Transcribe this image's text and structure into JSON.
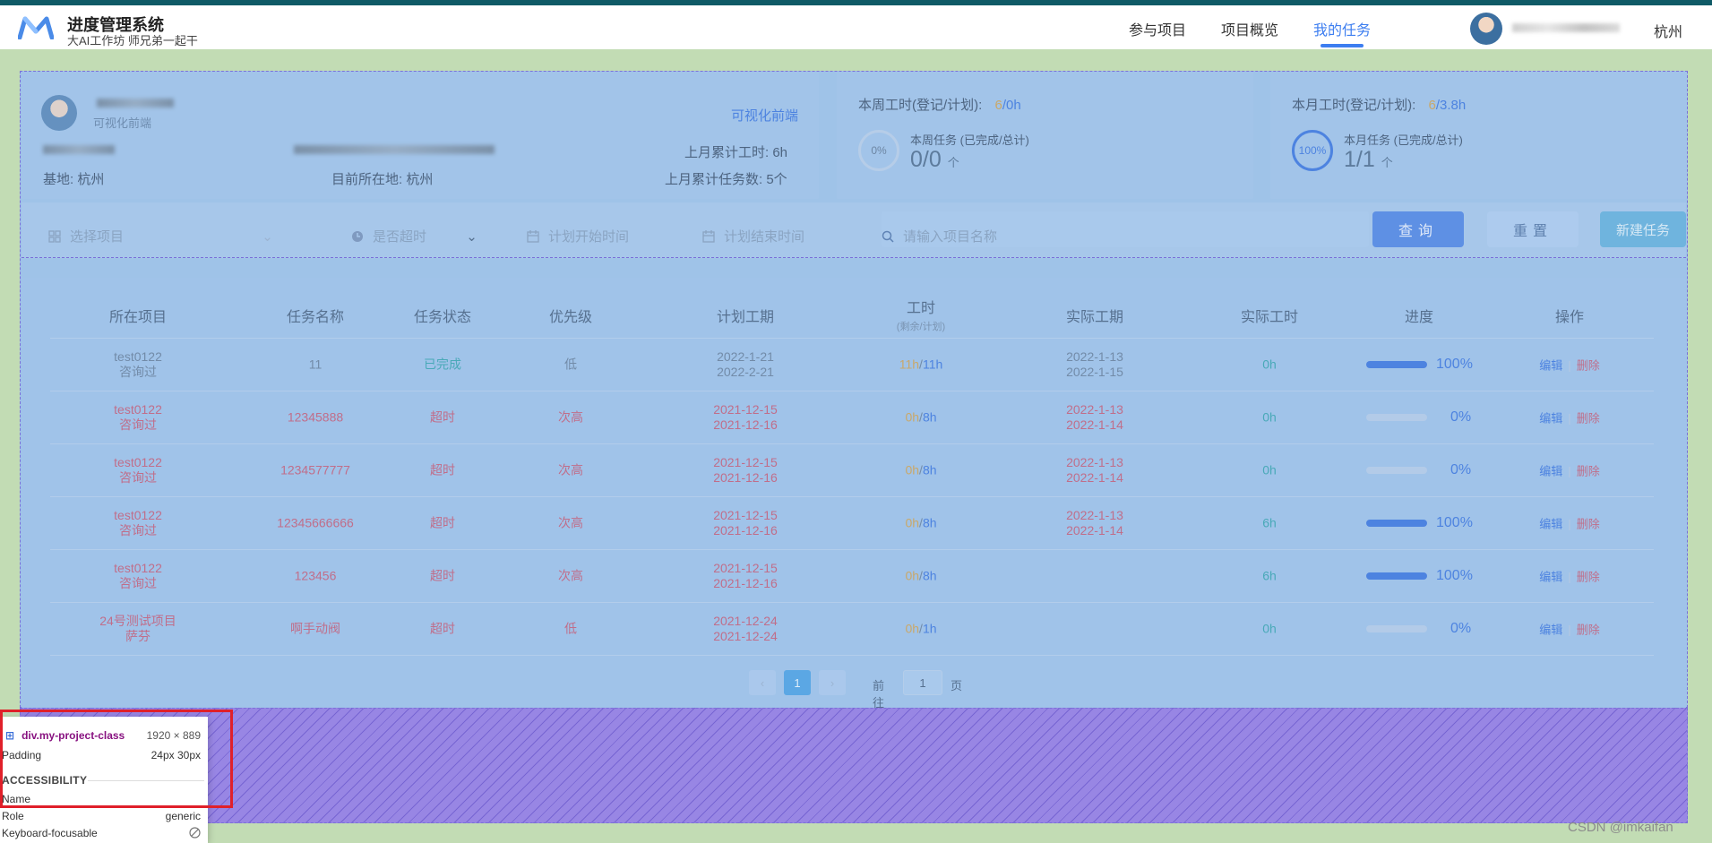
{
  "header": {
    "title": "进度管理系统",
    "subtitle": "大AI工作坊 师兄弟一起干",
    "nav": [
      "参与项目",
      "项目概览",
      "我的任务"
    ],
    "active_nav": "我的任务",
    "user_city": "杭州"
  },
  "profile": {
    "role": "可视化前端",
    "role_link": "可视化前端",
    "base_label": "基地:",
    "base": "杭州",
    "location_label": "目前所在地:",
    "location": "杭州",
    "last_month_hours_label": "上月累计工时:",
    "last_month_hours": "6h",
    "last_month_tasks_label": "上月累计任务数:",
    "last_month_tasks": "5个"
  },
  "week": {
    "label": "本周工时(登记/计划):",
    "logged": "6",
    "plan": "/0h",
    "ring": "0%",
    "tasks_label": "本周任务 (已完成/总计)",
    "tasks": "0/0",
    "unit": "个"
  },
  "month": {
    "label": "本月工时(登记/计划):",
    "logged": "6",
    "plan": "/3.8h",
    "ring": "100%",
    "tasks_label": "本月任务 (已完成/总计)",
    "tasks": "1/1",
    "unit": "个"
  },
  "filters": {
    "project_placeholder": "选择项目",
    "overdue_placeholder": "是否超时",
    "start_placeholder": "计划开始时间",
    "end_placeholder": "计划结束时间",
    "search_placeholder": "请输入项目名称",
    "query_label": "查询",
    "reset_label": "重置",
    "new_label": "新建任务"
  },
  "table": {
    "headers": [
      "所在项目",
      "任务名称",
      "任务状态",
      "优先级",
      "计划工期",
      "工时",
      "实际工期",
      "实际工时",
      "进度",
      "操作"
    ],
    "hours_sub": "(剩余/计划)",
    "edit_label": "编辑",
    "delete_label": "删除",
    "rows": [
      {
        "project": "test0122",
        "project_sub": "咨询过",
        "name": "11",
        "status": "已完成",
        "priority": "低",
        "plan_start": "2022-1-21",
        "plan_end": "2022-2-21",
        "remain": "11h",
        "plan_h": "11h",
        "act_start": "2022-1-13",
        "act_end": "2022-1-15",
        "actual_h": "0h",
        "progress": 100,
        "progress_text": "100%",
        "done": true
      },
      {
        "project": "test0122",
        "project_sub": "咨询过",
        "name": "12345888",
        "status": "超时",
        "priority": "次高",
        "plan_start": "2021-12-15",
        "plan_end": "2021-12-16",
        "remain": "0h",
        "plan_h": "8h",
        "act_start": "2022-1-13",
        "act_end": "2022-1-14",
        "actual_h": "0h",
        "progress": 0,
        "progress_text": "0%",
        "done": false
      },
      {
        "project": "test0122",
        "project_sub": "咨询过",
        "name": "1234577777",
        "status": "超时",
        "priority": "次高",
        "plan_start": "2021-12-15",
        "plan_end": "2021-12-16",
        "remain": "0h",
        "plan_h": "8h",
        "act_start": "2022-1-13",
        "act_end": "2022-1-14",
        "actual_h": "0h",
        "progress": 0,
        "progress_text": "0%",
        "done": false
      },
      {
        "project": "test0122",
        "project_sub": "咨询过",
        "name": "12345666666",
        "status": "超时",
        "priority": "次高",
        "plan_start": "2021-12-15",
        "plan_end": "2021-12-16",
        "remain": "0h",
        "plan_h": "8h",
        "act_start": "2022-1-13",
        "act_end": "2022-1-14",
        "actual_h": "6h",
        "progress": 100,
        "progress_text": "100%",
        "done": false
      },
      {
        "project": "test0122",
        "project_sub": "咨询过",
        "name": "123456",
        "status": "超时",
        "priority": "次高",
        "plan_start": "2021-12-15",
        "plan_end": "2021-12-16",
        "remain": "0h",
        "plan_h": "8h",
        "act_start": "",
        "act_end": "",
        "actual_h": "6h",
        "progress": 100,
        "progress_text": "100%",
        "done": false
      },
      {
        "project": "24号测试项目",
        "project_sub": "萨芬",
        "name": "啊手动阀",
        "status": "超时",
        "priority": "低",
        "plan_start": "2021-12-24",
        "plan_end": "2021-12-24",
        "remain": "0h",
        "plan_h": "1h",
        "act_start": "",
        "act_end": "",
        "actual_h": "0h",
        "progress": 0,
        "progress_text": "0%",
        "done": false
      }
    ]
  },
  "pagination": {
    "prev": "‹",
    "current": "1",
    "next": "›",
    "goto_label": "前往",
    "goto_value": "1",
    "page_label": "页"
  },
  "devtools": {
    "element": "div.my-project-class",
    "size": "1920 × 889",
    "padding_label": "Padding",
    "padding_value": "24px 30px",
    "accessibility": "ACCESSIBILITY",
    "name_label": "Name",
    "name_value": "",
    "role_label": "Role",
    "role_value": "generic",
    "focusable_label": "Keyboard-focusable",
    "focusable_icon": "no-icon"
  },
  "watermark": "CSDN @imkaifan",
  "colors": {
    "accent": "#3d7ef0",
    "overlay": "#9fc3e8",
    "padding_overlay": "#9886e4",
    "highlight_box": "#e0202a"
  }
}
